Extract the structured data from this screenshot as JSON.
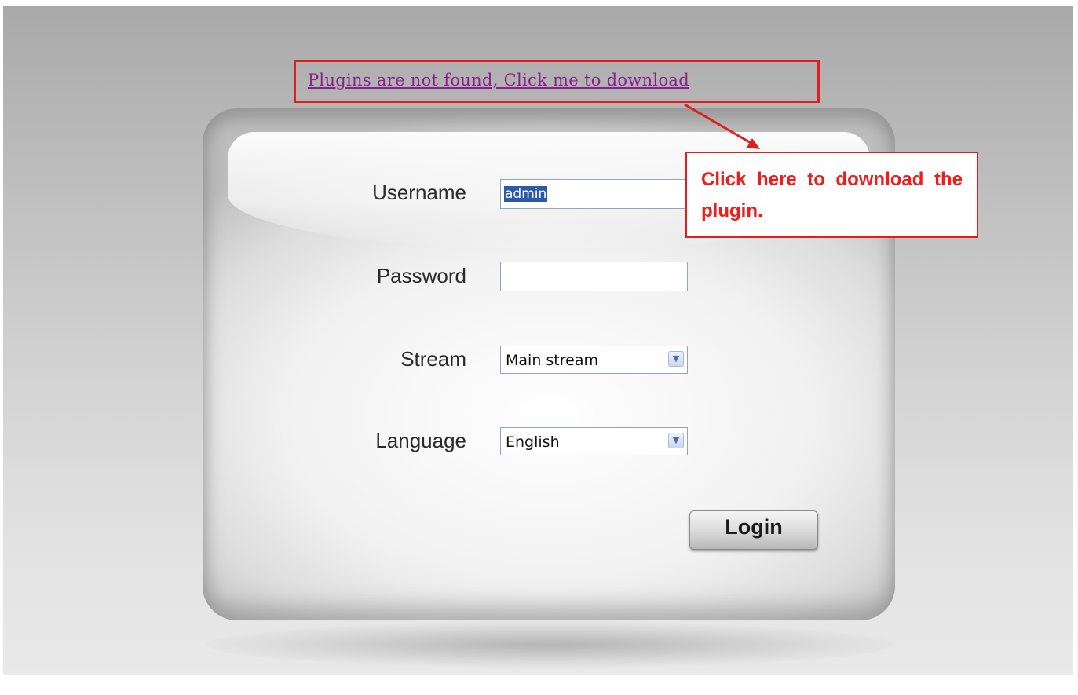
{
  "plugin_notice": {
    "link_text": "Plugins are not found, Click me to download"
  },
  "callout": {
    "text": "Click here to download the plugin."
  },
  "login_form": {
    "username_label": "Username",
    "username_value": "admin",
    "password_label": "Password",
    "password_value": "",
    "stream_label": "Stream",
    "stream_selected": "Main stream",
    "language_label": "Language",
    "language_selected": "English",
    "login_button": "Login"
  },
  "colors": {
    "annotation_red": "#e02020",
    "link_purple": "#8a1f8e",
    "selection_blue": "#2d5aa8"
  },
  "icons": {
    "dropdown": "chevron-down-icon",
    "annotation": "arrow-icon"
  }
}
